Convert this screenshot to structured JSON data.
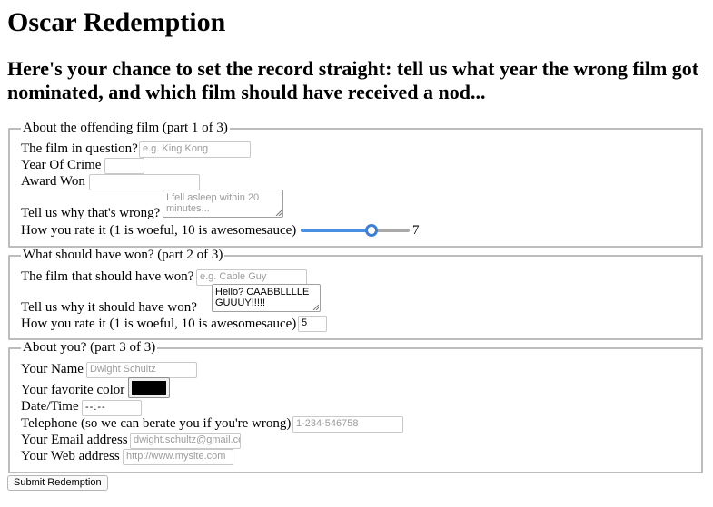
{
  "title": "Oscar Redemption",
  "subtitle": "Here's your chance to set the record straight: tell us what year the wrong film got nominated, and which film should have received a nod...",
  "part1": {
    "legend": "About the offending film (part 1 of 3)",
    "film_label": "The film in question?",
    "film_placeholder": "e.g. King Kong",
    "year_label": "Year Of Crime",
    "award_label": "Award Won",
    "why_label": "Tell us why that's wrong?",
    "why_placeholder": "I fell asleep within 20 minutes...",
    "rate_label": "How you rate it (1 is woeful, 10 is awesomesauce)",
    "rating": 7,
    "rating_min": 1,
    "rating_max": 10,
    "rating_display": "7"
  },
  "part2": {
    "legend": "What should have won? (part 2 of 3)",
    "film_label": "The film that should have won?",
    "film_placeholder": "e.g. Cable Guy",
    "why_label": "Tell us why it should have won?",
    "why_value": "Hello? CAABBLLLLE GUUUY!!!!!",
    "rate_label": "How you rate it (1 is woeful, 10 is awesomesauce)",
    "rating_value": "5"
  },
  "part3": {
    "legend": "About you? (part 3 of 3)",
    "name_label": "Your Name",
    "name_placeholder": "Dwight Schultz",
    "color_label": "Your favorite color",
    "favorite_color": "#000000",
    "datetime_label": "Date/Time",
    "datetime_placeholder": "--:--",
    "phone_label": "Telephone (so we can berate you if you're wrong)",
    "phone_placeholder": "1-234-546758",
    "email_label": "Your Email address",
    "email_placeholder": "dwight.schultz@gmail.com",
    "web_label": "Your Web address",
    "web_placeholder": "http://www.mysite.com"
  },
  "submit_label": "Submit Redemption",
  "colors": {
    "accent": "#3c7fd8",
    "fieldset_border": "#bdbdbd"
  }
}
